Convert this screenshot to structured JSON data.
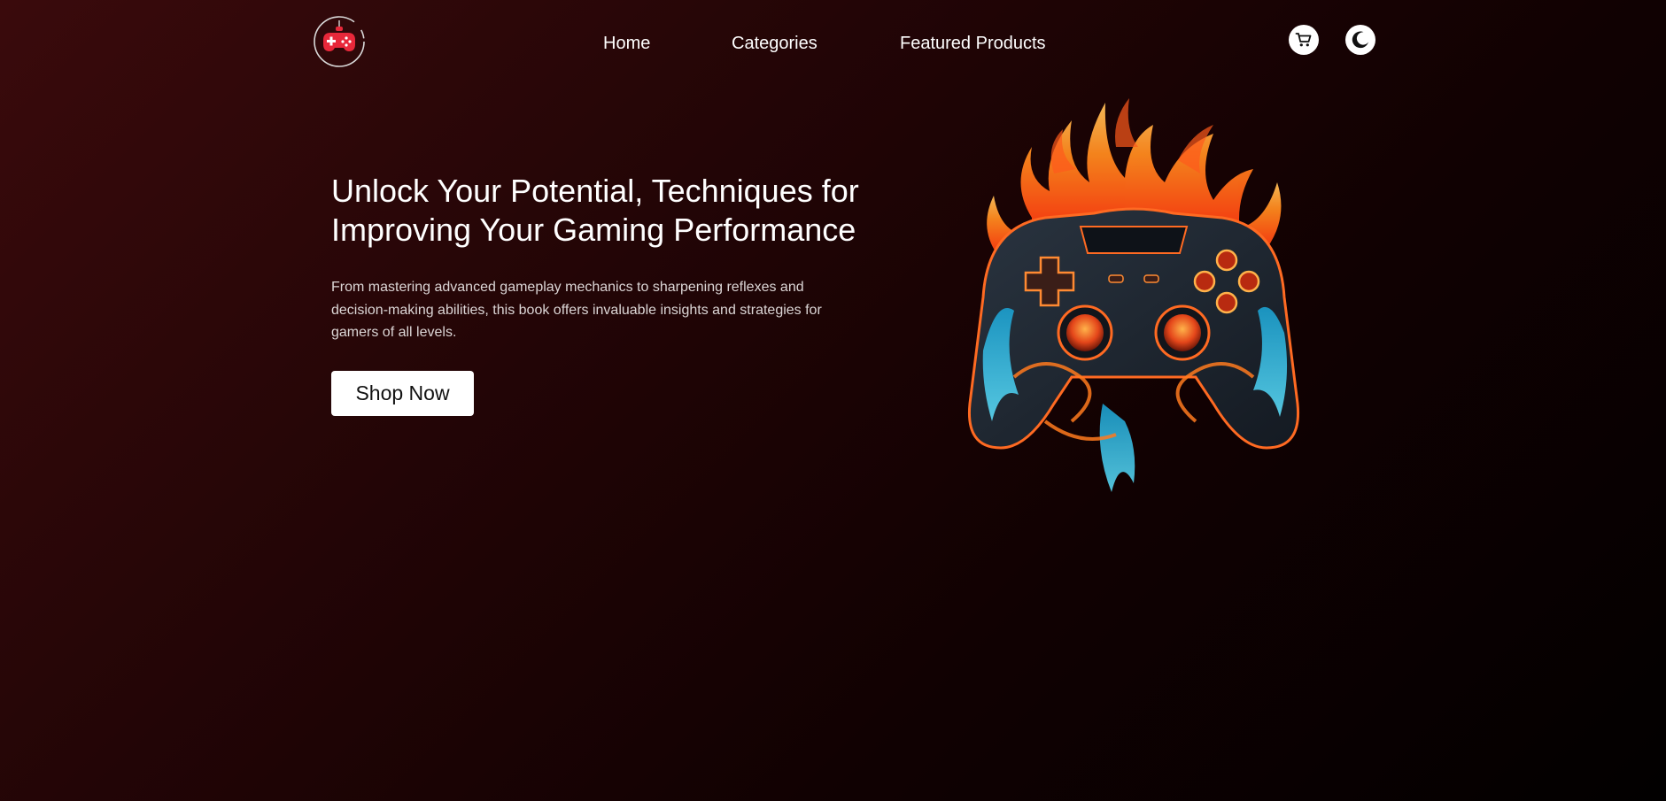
{
  "nav": {
    "links": [
      {
        "label": "Home"
      },
      {
        "label": "Categories"
      },
      {
        "label": "Featured Products"
      }
    ],
    "cart_icon": "cart-icon",
    "theme_icon": "moon-icon"
  },
  "logo": {
    "icon": "gamepad-logo-icon"
  },
  "hero": {
    "title": "Unlock Your Potential, Techniques for Improving Your Gaming Performance",
    "description": "From mastering advanced gameplay mechanics to sharpening reflexes and decision-making abilities, this book offers invaluable insights and strategies for gamers of all levels.",
    "cta_label": "Shop Now",
    "image_icon": "flaming-controller-image"
  },
  "colors": {
    "background_top": "#3a0a0c",
    "background_bottom": "#020000",
    "accent": "#e8283a",
    "button_bg": "#ffffff"
  }
}
